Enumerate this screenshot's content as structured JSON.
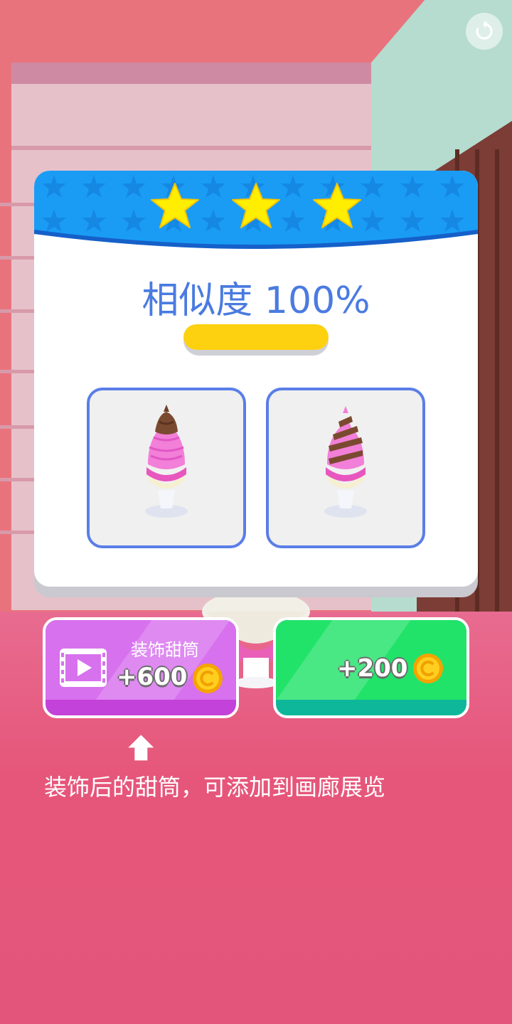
{
  "level_result": {
    "stars_earned": 3,
    "stars_total": 3,
    "similarity_text": "相似度 100%",
    "similarity_progress": 1.0
  },
  "colors": {
    "header_blue": "#1a9cf5",
    "star_yellow": "#ffee00",
    "text_blue": "#4a7be0",
    "progress_yellow": "#fdd10f",
    "card_border": "#5a7ee8",
    "purple_button": "#d771ee",
    "green_button": "#21e36a",
    "floor_pink": "#e6567a"
  },
  "cards": [
    {
      "name": "target-dessert",
      "description_icon": "ice-cream-sundae-icon"
    },
    {
      "name": "player-dessert",
      "description_icon": "ice-cream-sundae-icon"
    }
  ],
  "buttons": {
    "decorate": {
      "label": "装饰甜筒",
      "reward": "+600",
      "icon": "video-ad-icon",
      "coin_icon": "coin-icon"
    },
    "claim": {
      "reward": "+200",
      "coin_icon": "coin-icon"
    }
  },
  "hint": {
    "text": "装饰后的甜筒，可添加到画廊展览",
    "icon": "arrow-up-icon"
  },
  "top_bar": {
    "restart_icon": "restart-icon"
  }
}
